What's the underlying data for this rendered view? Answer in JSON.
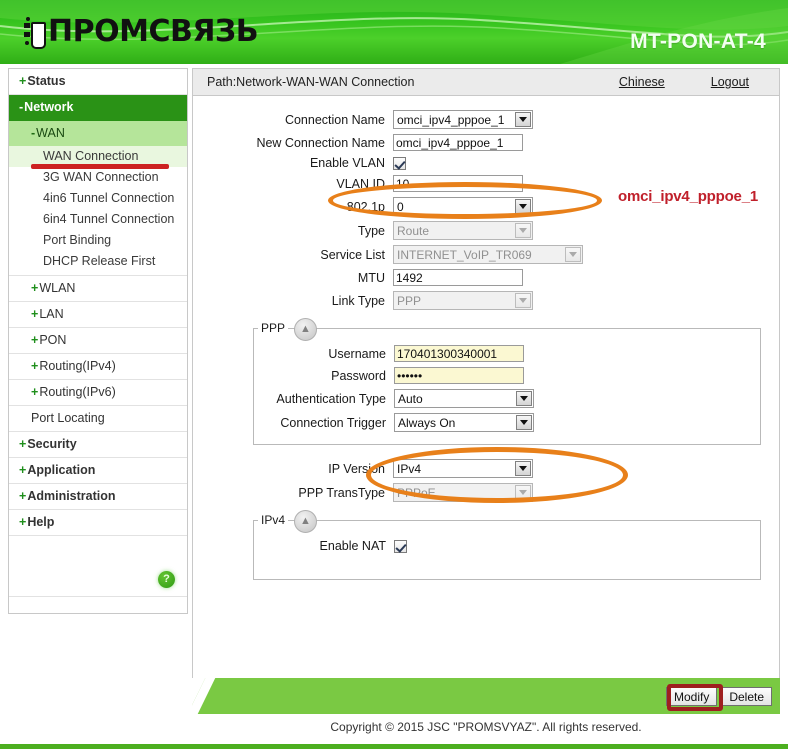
{
  "header": {
    "logo_text": "ПРОМСВЯЗЬ",
    "logo_icon": "plug-icon",
    "model": "MT-PON-AT-4",
    "brand_green": "#37c41f"
  },
  "sidebar": {
    "items": [
      {
        "label": "Status",
        "prefix": "+",
        "level": 1,
        "state": "collapsed"
      },
      {
        "label": "Network",
        "prefix": "-",
        "level": 1,
        "state": "expanded-active"
      },
      {
        "label": "WAN",
        "prefix": "-",
        "level": 2,
        "state": "expanded"
      },
      {
        "label": "WAN Connection",
        "prefix": "",
        "level": 3,
        "state": "current"
      },
      {
        "label": "3G WAN Connection",
        "prefix": "",
        "level": 3,
        "state": "normal"
      },
      {
        "label": "4in6 Tunnel Connection",
        "prefix": "",
        "level": 3,
        "state": "normal"
      },
      {
        "label": "6in4 Tunnel Connection",
        "prefix": "",
        "level": 3,
        "state": "normal"
      },
      {
        "label": "Port Binding",
        "prefix": "",
        "level": 3,
        "state": "normal"
      },
      {
        "label": "DHCP Release First",
        "prefix": "",
        "level": 3,
        "state": "normal"
      },
      {
        "label": "WLAN",
        "prefix": "+",
        "level": 2,
        "state": "collapsed"
      },
      {
        "label": "LAN",
        "prefix": "+",
        "level": 2,
        "state": "collapsed"
      },
      {
        "label": "PON",
        "prefix": "+",
        "level": 2,
        "state": "collapsed"
      },
      {
        "label": "Routing(IPv4)",
        "prefix": "+",
        "level": 2,
        "state": "collapsed"
      },
      {
        "label": "Routing(IPv6)",
        "prefix": "+",
        "level": 2,
        "state": "collapsed"
      },
      {
        "label": "Port Locating",
        "prefix": "",
        "level": 2,
        "state": "normal"
      },
      {
        "label": "Security",
        "prefix": "+",
        "level": 1,
        "state": "collapsed"
      },
      {
        "label": "Application",
        "prefix": "+",
        "level": 1,
        "state": "collapsed"
      },
      {
        "label": "Administration",
        "prefix": "+",
        "level": 1,
        "state": "collapsed"
      },
      {
        "label": "Help",
        "prefix": "+",
        "level": 1,
        "state": "collapsed"
      }
    ],
    "help_icon": "question-mark-icon",
    "help_glyph": "?"
  },
  "pathbar": {
    "path": "Path:Network-WAN-WAN Connection",
    "chinese_link": "Chinese",
    "logout_link": "Logout"
  },
  "form": {
    "connection_name": {
      "label": "Connection Name",
      "value": "omci_ipv4_pppoe_1"
    },
    "new_connection_name": {
      "label": "New Connection Name",
      "value": "omci_ipv4_pppoe_1"
    },
    "enable_vlan": {
      "label": "Enable VLAN",
      "checked": true
    },
    "vlan_id": {
      "label": "VLAN ID",
      "value": "10"
    },
    "p8021p": {
      "label": "802.1p",
      "value": "0"
    },
    "type": {
      "label": "Type",
      "value": "Route",
      "disabled": true
    },
    "service_list": {
      "label": "Service List",
      "value": "INTERNET_VoIP_TR069",
      "disabled": true
    },
    "mtu": {
      "label": "MTU",
      "value": "1492"
    },
    "link_type": {
      "label": "Link Type",
      "value": "PPP",
      "disabled": true
    },
    "ppp_group": {
      "legend": "PPP",
      "collapse_icon": "chevron-double-up-icon",
      "username": {
        "label": "Username",
        "value": "170401300340001"
      },
      "password": {
        "label": "Password",
        "value": "••••••"
      },
      "auth_type": {
        "label": "Authentication Type",
        "value": "Auto"
      },
      "conn_trigger": {
        "label": "Connection Trigger",
        "value": "Always On"
      }
    },
    "ip_version": {
      "label": "IP Version",
      "value": "IPv4"
    },
    "ppp_transtype": {
      "label": "PPP TransType",
      "value": "PPPoE",
      "disabled": true
    },
    "ipv4_group": {
      "legend": "IPv4",
      "collapse_icon": "chevron-double-up-icon",
      "enable_nat": {
        "label": "Enable NAT",
        "checked": true
      }
    }
  },
  "annotations": {
    "connection_name_note": "omci_ipv4_pppoe_1",
    "ellipse_color": "#e8801a",
    "rect_color": "#9e1f1f",
    "note_color": "#c0202b",
    "sidebar_underline_color": "#cc2222"
  },
  "footer": {
    "modify_label": "Modify",
    "delete_label": "Delete",
    "copyright": "Copyright © 2015 JSC \"PROMSVYAZ\". All rights reserved."
  }
}
